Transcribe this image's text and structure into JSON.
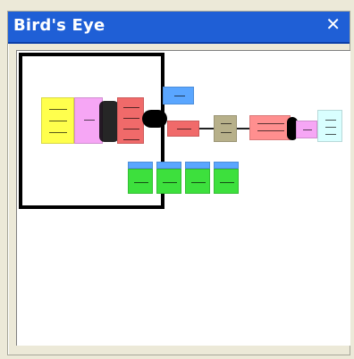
{
  "window": {
    "title": "Bird's Eye",
    "close_glyph": "✕"
  },
  "colors": {
    "titlebar": "#1f5fd6",
    "yellow": "#ffff4d",
    "pink": "#f6a6f5",
    "red": "#f06a6a",
    "blue": "#5aa6ff",
    "olive": "#b7b08a",
    "salmon": "#ff8f8f",
    "cyan": "#d9ffff",
    "green": "#3de03d"
  }
}
